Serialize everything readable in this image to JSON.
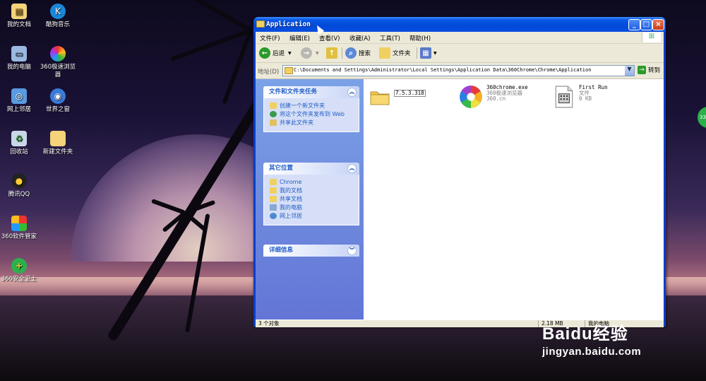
{
  "desktop": {
    "icons": [
      {
        "label": "我的文档",
        "icon": "my-documents-icon"
      },
      {
        "label": "酷狗音乐",
        "icon": "kugou-music-icon"
      },
      {
        "label": "我的电脑",
        "icon": "my-computer-icon"
      },
      {
        "label": "360极速浏览器",
        "icon": "360-browser-icon"
      },
      {
        "label": "网上邻居",
        "icon": "network-places-icon"
      },
      {
        "label": "世界之窗",
        "icon": "theworld-browser-icon"
      },
      {
        "label": "回收站",
        "icon": "recycle-bin-icon"
      },
      {
        "label": "新建文件夹",
        "icon": "folder-icon"
      },
      {
        "label": "腾讯QQ",
        "icon": "qq-icon"
      },
      {
        "label": "360软件管家",
        "icon": "360-software-manager-icon"
      },
      {
        "label": "360安全卫士",
        "icon": "360-safeguard-icon"
      }
    ]
  },
  "window": {
    "title": "Application",
    "controls": {
      "minimize": "_",
      "maximize": "□",
      "close": "×"
    },
    "menus": [
      "文件(F)",
      "编辑(E)",
      "查看(V)",
      "收藏(A)",
      "工具(T)",
      "帮助(H)"
    ],
    "toolbar": {
      "back": "后退",
      "search": "搜索",
      "folders": "文件夹"
    },
    "address": {
      "label": "地址(D)",
      "value": "C:\\Documents and Settings\\Administrator\\Local Settings\\Application Data\\360Chrome\\Chrome\\Application",
      "go": "转到"
    },
    "tasks_panel": {
      "title": "文件和文件夹任务",
      "items": [
        "创建一个新文件夹",
        "将这个文件夹发布到 Web",
        "共享此文件夹"
      ]
    },
    "places_panel": {
      "title": "其它位置",
      "items": [
        "Chrome",
        "我的文档",
        "共享文档",
        "我的电脑",
        "网上邻居"
      ]
    },
    "details_panel": {
      "title": "详细信息"
    },
    "files": [
      {
        "name": "7.5.3.318",
        "line2": "",
        "line3": "",
        "icon": "folder-icon"
      },
      {
        "name": "360chrome.exe",
        "line2": "360极速浏览器",
        "line3": "360.cn",
        "icon": "360-browser-icon"
      },
      {
        "name": "First Run",
        "line2": "文件",
        "line3": "0 KB",
        "icon": "file-icon"
      }
    ],
    "status": {
      "count": "3 个对象",
      "size": "2.18 MB",
      "location": "我的电脑"
    }
  },
  "overlay": {
    "badge": "33",
    "watermark_logo": "Baidu经验",
    "watermark_url": "jingyan.baidu.com"
  },
  "colors": {
    "titlebar": "#0a58e6",
    "task_pane": "#6375d6",
    "link": "#215dc6"
  }
}
